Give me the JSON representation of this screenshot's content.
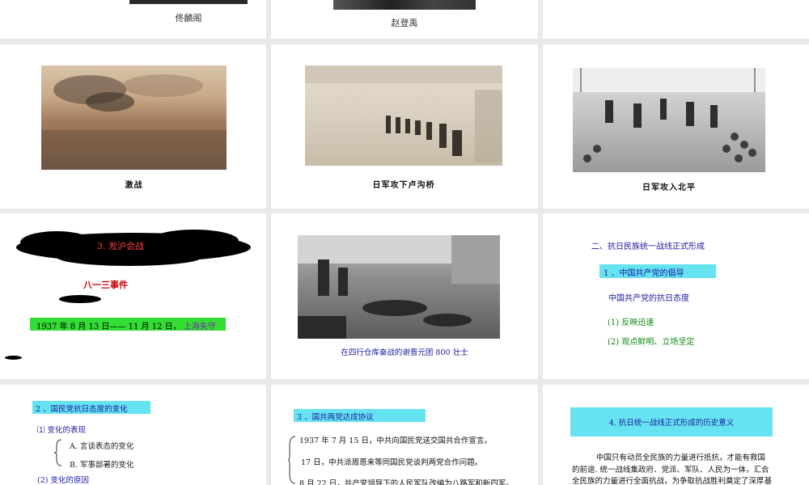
{
  "row1": {
    "s1_caption": "佟麟阁",
    "s2_caption": "赵登禹"
  },
  "row2": {
    "s1_caption": "激战",
    "s2_caption": "日军攻下卢沟桥",
    "s3_caption": "日军攻入北平"
  },
  "row3": {
    "s1": {
      "cloud_title": "3. 淞沪会战",
      "subtitle": "八一三事件",
      "date_line": "1937 年 8 月 13 日—— 11 月 12 日，",
      "date_tail": "上海失守"
    },
    "s2": {
      "caption": "在四行仓库奋战的谢晋元团 800  壮士"
    },
    "s3": {
      "title": "二、抗日民族统一战线正式形成",
      "section": "1 、中国共产党的倡导",
      "stance": "中国共产党的抗日态度",
      "point1": "(1)  反映迅速",
      "point2": "(2)  观点鲜明、立场坚定"
    }
  },
  "row4": {
    "s1": {
      "heading": "2 、国民党抗日态度的变化",
      "sub1": "⑴ 变化的表现",
      "itemA": "A. 言谈表态的变化",
      "itemB": "B. 军事部署的变化",
      "sub2": "(2)  变化的原因"
    },
    "s2": {
      "heading": "3 、国共两党达成协议",
      "line1": "1937 年 7 月 15 日，中共向国民党送交国共合作宣言。",
      "line2": "17 日，中共派周恩来等同国民党谈判两党合作问题。",
      "line3": "8 月 22 日，共产党领导下的人民军队改编为八路军和新四军。"
    },
    "s3": {
      "heading": "4. 抗日统一战线正式形成的历史意义",
      "para1": "中国只有动员全民族的力量进行抵抗，才能有救国",
      "para2": "的前途. 统一战线集政府、党派、军队、人民为一体，汇合",
      "para3": "全民族的力量进行全面抗战，为争取抗战胜利奠定了深厚基"
    }
  }
}
